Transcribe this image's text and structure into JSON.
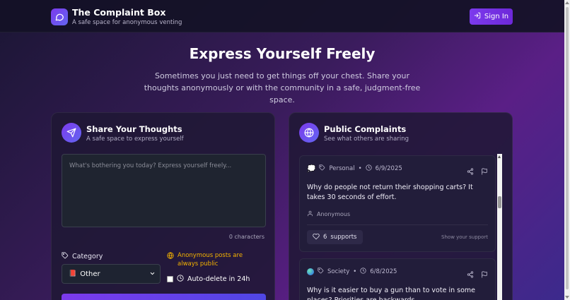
{
  "app": {
    "title": "The Complaint Box",
    "subtitle": "A safe space for anonymous venting",
    "signin_label": "Sign In",
    "accent": "#7c3aed"
  },
  "hero": {
    "title": "Express Yourself Freely",
    "description": "Sometimes you just need to get things off your chest. Share your thoughts anonymously or with the community in a safe, judgment-free space."
  },
  "compose": {
    "title": "Share Your Thoughts",
    "subtitle": "A safe space to express yourself",
    "placeholder": "What's bothering you today? Express yourself freely...",
    "char_count": "0 characters",
    "category_label": "Category",
    "category_value": "Other",
    "category_emoji": "📕",
    "anon_note": "Anonymous posts are always public",
    "autodelete_label": "Auto-delete in 24h"
  },
  "feed": {
    "title": "Public Complaints",
    "subtitle": "See what others are sharing",
    "complaints": [
      {
        "emoji_icon": "speech-bubble-icon",
        "category": "Personal",
        "date": "6/9/2025",
        "text": "Why do people not return their shopping carts? It takes 30 seconds of effort.",
        "author": "Anonymous",
        "support_count": "6",
        "support_label": "supports",
        "show_support": "Show your support"
      },
      {
        "emoji_icon": "globe-emoji-icon",
        "category": "Society",
        "date": "6/8/2025",
        "text": "Why is it easier to buy a gun than to vote in some places? Priorities are backwards."
      }
    ]
  }
}
